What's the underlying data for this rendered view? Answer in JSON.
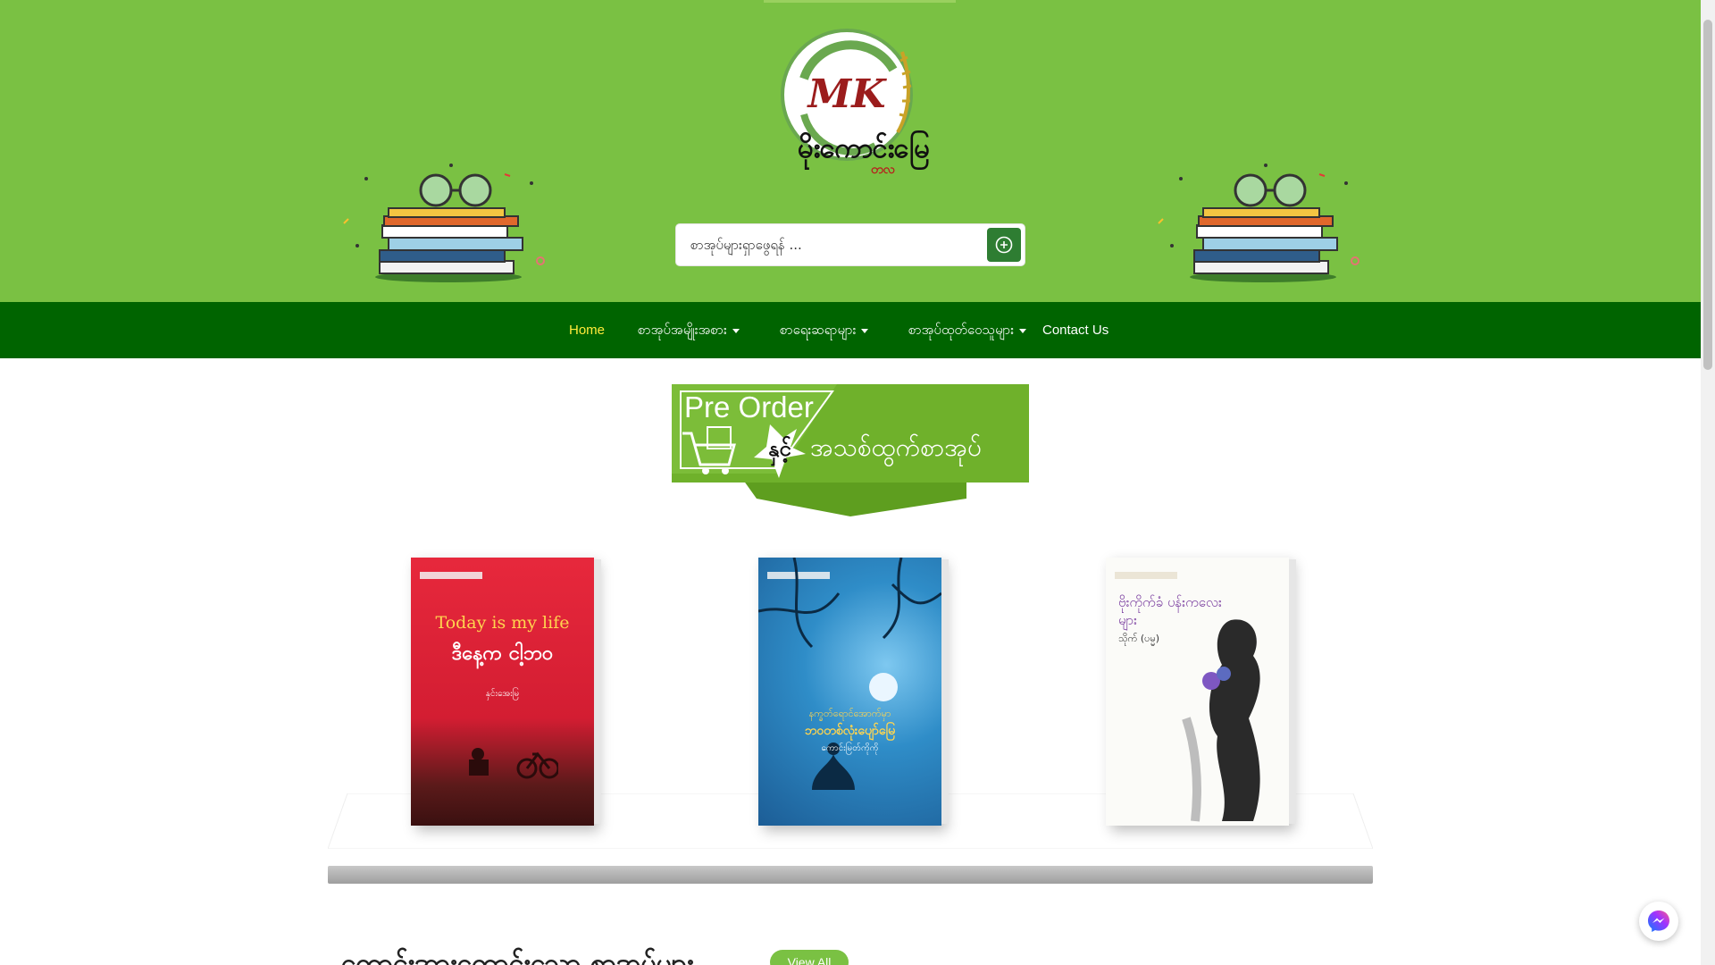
{
  "header": {
    "logo_initials": "MK",
    "logo_text": "မိုးကောင်းမြေ",
    "logo_sub": "တလ",
    "search_placeholder": "စာအုပ်များရှာဖွေရန် ..."
  },
  "nav": {
    "items": [
      {
        "label": "Home",
        "dropdown": false
      },
      {
        "label": "စာအုပ်အမျိုးအစား",
        "dropdown": true
      },
      {
        "label": "စာရေးဆရာများ",
        "dropdown": true
      },
      {
        "label": "စာအုပ်ထုတ်ဝေသူများ",
        "dropdown": true
      },
      {
        "label": "Contact Us",
        "dropdown": false
      }
    ]
  },
  "banner": {
    "line1": "Pre Order",
    "line2": "နှင့်",
    "line3": "အသစ်ထွက်စာအုပ်"
  },
  "books": [
    {
      "title_en": "Today is my life",
      "title_mm": "ဒီနေ့က ငါ့ဘဝ",
      "author": "နှင်းအေးမြ"
    },
    {
      "title_mm_top": "နက္ခတ်ရောင်အောက်မှာ",
      "title_mm": "ဘဝတစ်လုံးပျော်မြေ",
      "author": "ကောင်းမြတ်ကိုကို"
    },
    {
      "title_mm": "ဗိုးကိုက်ခံ ပန်းကလေးများ",
      "author": "သိုက် (ပမ္မ)"
    }
  ],
  "section": {
    "title": "ကောင်းအားကောင်းသော စာအုပ်များ",
    "view_all": "View All"
  },
  "colors": {
    "header_green": "#7ac143",
    "nav_green": "#006400",
    "active_link": "#ffeb3b"
  },
  "icons": {
    "search": "search-icon",
    "messenger": "messenger-icon"
  }
}
